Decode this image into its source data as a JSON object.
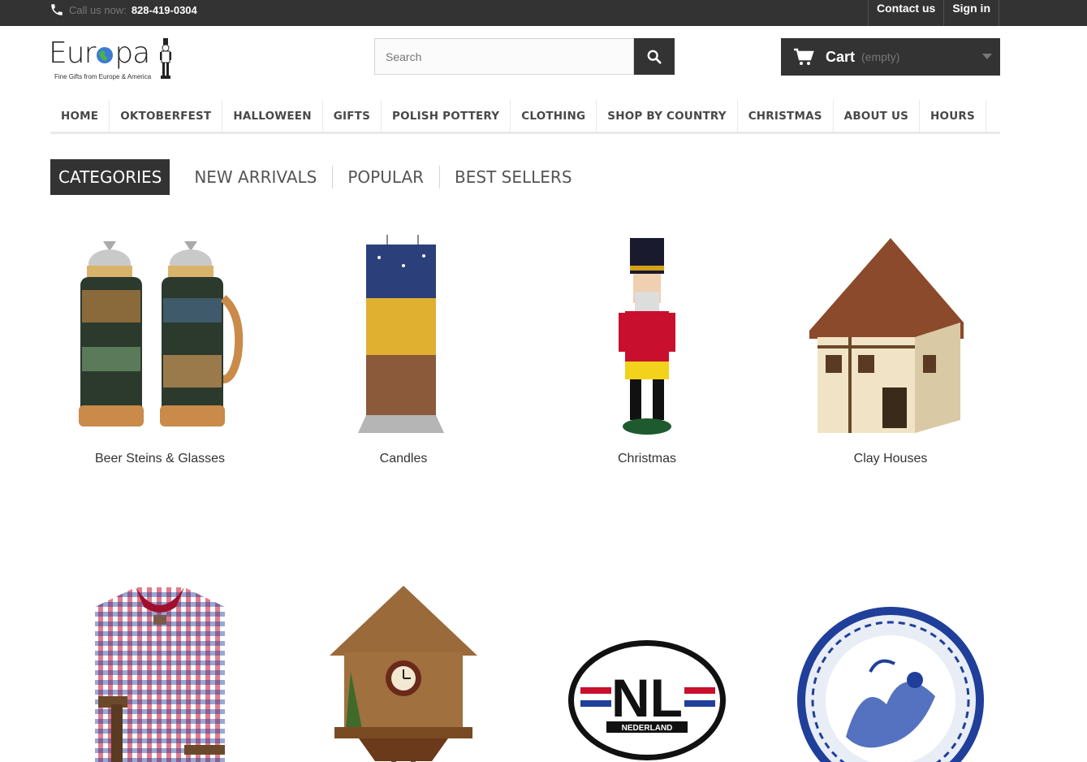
{
  "topbar": {
    "call_label": "Call us now:",
    "phone": "828-419-0304",
    "contact": "Contact us",
    "signin": "Sign in"
  },
  "logo": {
    "name": "Europa",
    "tagline": "Fine Gifts from Europe & America"
  },
  "search": {
    "placeholder": "Search"
  },
  "cart": {
    "label": "Cart",
    "status": "(empty)"
  },
  "menu": [
    "HOME",
    "OKTOBERFEST",
    "HALLOWEEN",
    "GIFTS",
    "POLISH POTTERY",
    "CLOTHING",
    "SHOP BY COUNTRY",
    "CHRISTMAS",
    "ABOUT US",
    "HOURS"
  ],
  "tabs": [
    "CATEGORIES",
    "NEW ARRIVALS",
    "POPULAR",
    "BEST SELLERS"
  ],
  "products": [
    {
      "name": "Beer Steins & Glasses",
      "icon": "beer-stein-image"
    },
    {
      "name": "Candles",
      "icon": "candle-image"
    },
    {
      "name": "Christmas",
      "icon": "nutcracker-image"
    },
    {
      "name": "Clay Houses",
      "icon": "clay-house-image"
    },
    {
      "name": "",
      "icon": "shirt-image"
    },
    {
      "name": "",
      "icon": "cuckoo-clock-image"
    },
    {
      "name": "",
      "icon": "nl-sticker-image"
    },
    {
      "name": "",
      "icon": "delft-plate-image"
    }
  ],
  "sticker": {
    "code": "NL",
    "country": "NEDERLAND"
  },
  "colors": {
    "dark": "#333333",
    "accent_red": "#c8102e",
    "delft_blue": "#1f3f9a"
  }
}
